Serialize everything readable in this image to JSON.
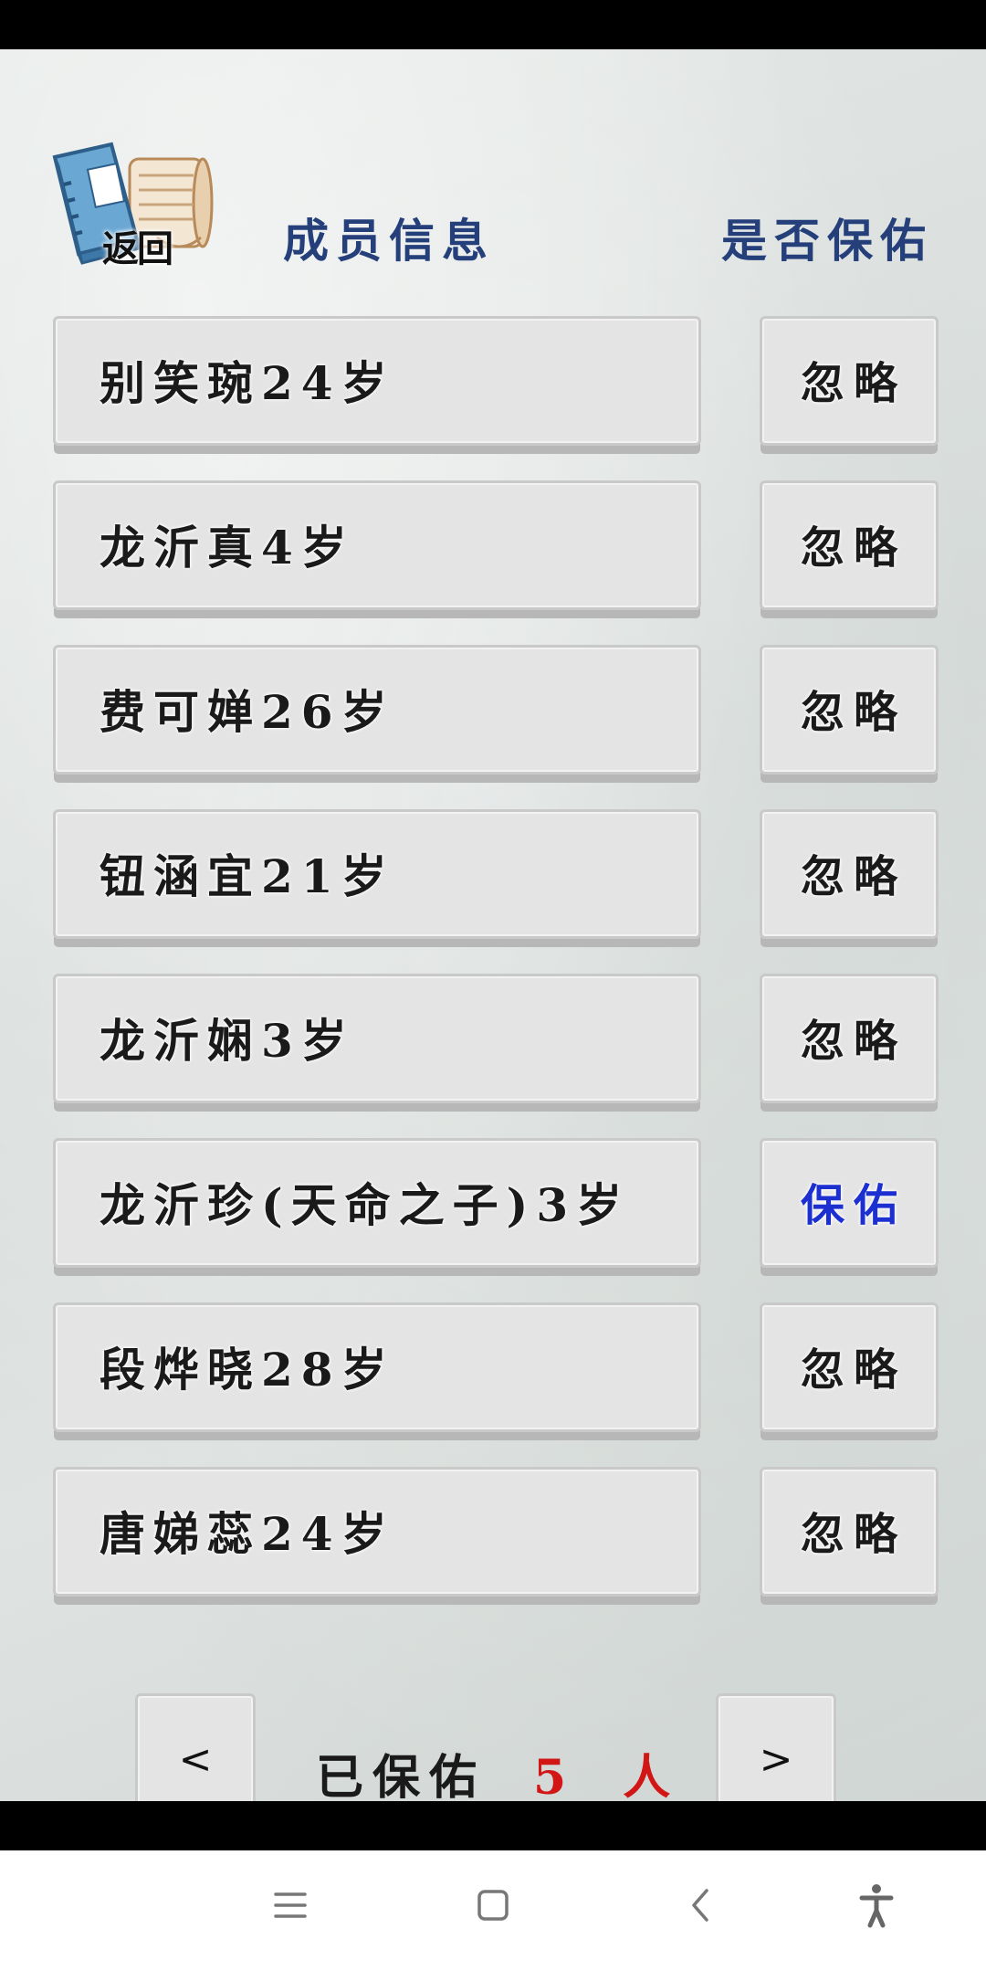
{
  "header": {
    "back_label": "返回",
    "col_member": "成员信息",
    "col_protect": "是否保佑"
  },
  "members": [
    {
      "name": "别笑琬24岁",
      "action": "忽略",
      "protected": false
    },
    {
      "name": "龙沂真4岁",
      "action": "忽略",
      "protected": false
    },
    {
      "name": "费可婵26岁",
      "action": "忽略",
      "protected": false
    },
    {
      "name": "钮涵宜21岁",
      "action": "忽略",
      "protected": false
    },
    {
      "name": "龙沂娴3岁",
      "action": "忽略",
      "protected": false
    },
    {
      "name": "龙沂珍(天命之子)3岁",
      "action": "保佑",
      "protected": true
    },
    {
      "name": "段烨晓28岁",
      "action": "忽略",
      "protected": false
    },
    {
      "name": "唐娣蕊24岁",
      "action": "忽略",
      "protected": false
    }
  ],
  "pager": {
    "prev_label": "<",
    "next_label": ">",
    "status_label": "已保佑",
    "count_text": "5 人"
  },
  "colors": {
    "header_text": "#243f7a",
    "protected_text": "#1c2fd0",
    "count_text": "#d21616"
  },
  "nav_icons": [
    "menu-icon",
    "home-square-icon",
    "back-chevron-icon",
    "accessibility-icon"
  ]
}
